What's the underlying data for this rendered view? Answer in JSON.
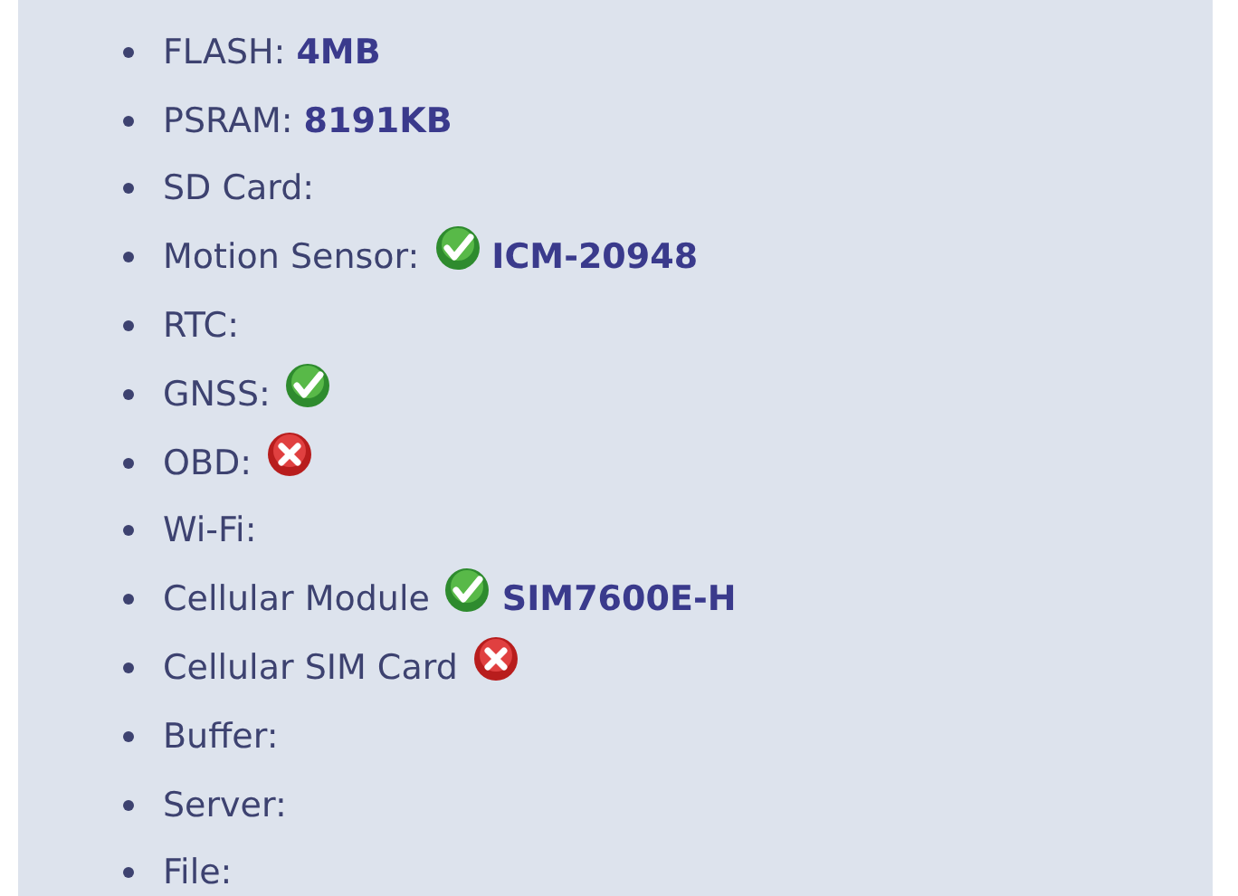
{
  "items": [
    {
      "kind": "plain",
      "label": "FLASH:",
      "value": "4MB"
    },
    {
      "kind": "plain",
      "label": "PSRAM:",
      "value": "8191KB"
    },
    {
      "kind": "plain",
      "label": "SD Card:"
    },
    {
      "kind": "check",
      "label": "Motion Sensor:",
      "value": "ICM-20948"
    },
    {
      "kind": "plain",
      "label": "RTC:"
    },
    {
      "kind": "check",
      "label": "GNSS:"
    },
    {
      "kind": "cross",
      "label": "OBD:"
    },
    {
      "kind": "plain",
      "label": "Wi-Fi:"
    },
    {
      "kind": "check",
      "label": "Cellular Module",
      "value": "SIM7600E-H"
    },
    {
      "kind": "cross",
      "label": "Cellular SIM Card"
    },
    {
      "kind": "plain",
      "label": "Buffer:"
    },
    {
      "kind": "plain",
      "label": "Server:"
    },
    {
      "kind": "plain",
      "label": "File:"
    }
  ]
}
